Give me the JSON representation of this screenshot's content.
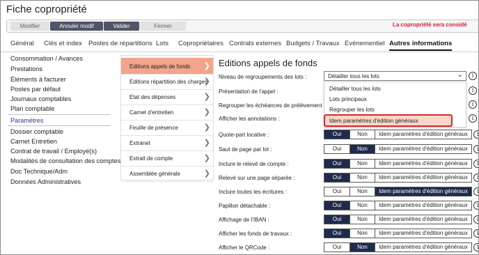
{
  "title": "Fiche copropriété",
  "toolbar": {
    "modifier": "Modifier",
    "annuler": "Annuler modif",
    "valider": "Valider",
    "fermer": "Fermer",
    "warning": "La copropriété sera considé"
  },
  "tabs": [
    "Général",
    "Clés et index",
    "Postes de répartitions",
    "Lots",
    "Copropriétaires",
    "Contrats externes",
    "Budgets / Travaux",
    "Evénementiel",
    "Autres informations"
  ],
  "sidebar": {
    "group1": [
      "Consommation / Avances",
      "Prestations",
      "Éléments à facturer",
      "Postes par défaut",
      "Journaux comptables",
      "Plan comptable"
    ],
    "selected": "Paramètres",
    "group2": [
      "Dossier comptable",
      "Carnet Entretien",
      "Contrat de travail / Employé(s)",
      "Modalités de consultation des comptes",
      "Doc Technique/Adm",
      "Données Administratives"
    ]
  },
  "submenu": [
    "Editions appels de fonds",
    "Editions répartition des charges",
    "Etat des dépenses",
    "Carnet d'entretien",
    "Feuille de présence",
    "Extranet",
    "Extrait de compte",
    "Assemblée générale"
  ],
  "panel": {
    "title": "Editions appels de fonds",
    "select_label": "Niveau de regroupements des lots :",
    "select_value": "Détailler tous les lots",
    "dropdown_options": [
      "Détailler tous les lots",
      "Lots principaux",
      "Regrouper les lots",
      "Idem paramètres d'édition généraux"
    ],
    "labels_under_dropdown": [
      "Présentation de l'appel :",
      "Regrouper les échéances de prélèvement :",
      "Afficher les annotations :"
    ],
    "rows": [
      {
        "label": "Quote-part locative :",
        "selected": "oui"
      },
      {
        "label": "Saut de page par lot :",
        "selected": "non"
      },
      {
        "label": "Inclure le relevé de compte :",
        "selected": "oui"
      },
      {
        "label": "Relevé sur une page séparée :",
        "selected": "oui"
      },
      {
        "label": "Inclure toutes les écritures :",
        "selected": "idem"
      },
      {
        "label": "Papillon détachable :",
        "selected": "oui"
      },
      {
        "label": "Affichage de l'IBAN :",
        "selected": "oui"
      },
      {
        "label": "Afficher les fonds de travaux :",
        "selected": "oui"
      },
      {
        "label": "Afficher le QRCode :",
        "selected": "non"
      }
    ],
    "seg_labels": {
      "oui": "Oui",
      "non": "Non",
      "idem": "Idem paramètres d'édition généraux"
    }
  },
  "info_icon": "i",
  "colors": {
    "accent_dark": "#1f2b4d",
    "highlight": "#f2a48c",
    "warning": "#d3202a"
  }
}
